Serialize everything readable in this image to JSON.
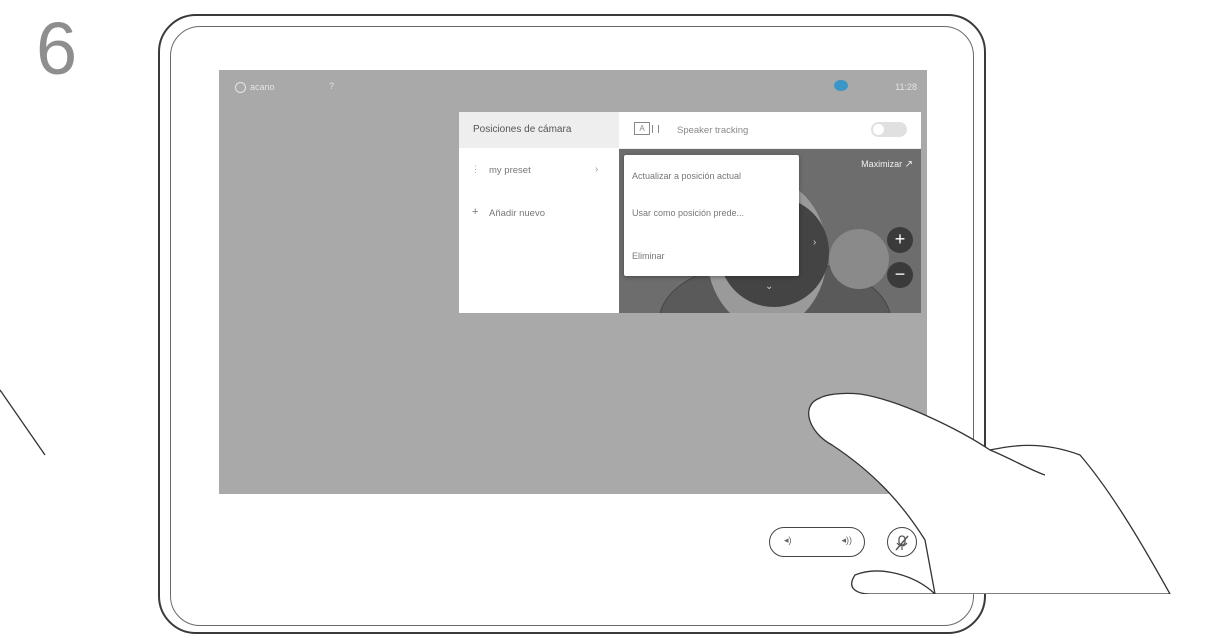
{
  "step": {
    "number": "6"
  },
  "statusbar": {
    "device_name": "acano",
    "info_glyph": "?",
    "time": "11:28",
    "status_color": "#3b96c8"
  },
  "panel": {
    "title": "Posiciones de cámara",
    "presets": [
      {
        "label": "my preset"
      }
    ],
    "add_label": "Añadir nuevo",
    "tracking_label": "Speaker tracking",
    "tracking_icon_text": "A",
    "tracking_on": false
  },
  "video": {
    "maximize_label": "Maximizar",
    "maximize_icon": "↗",
    "zoom_in": "+",
    "zoom_out": "−",
    "pad_down": "⌄",
    "pad_right": "›"
  },
  "context_menu": {
    "items": [
      "Actualizar a posición actual",
      "Usar como posición prede...",
      "Eliminar"
    ]
  },
  "controls": {
    "volume_low_icon": "◂)",
    "volume_high_icon": "◂))",
    "mute_icon": "mic-slash-icon"
  },
  "icons": {
    "preset_handle": "⋮",
    "preset_chevron": "›",
    "add_plus": "+",
    "mute_glyph": "🎙"
  },
  "colors": {
    "screen_bg": "#a9a9a9",
    "panel_header_bg": "#eeeeee",
    "accent_blue": "#3b96c8"
  }
}
